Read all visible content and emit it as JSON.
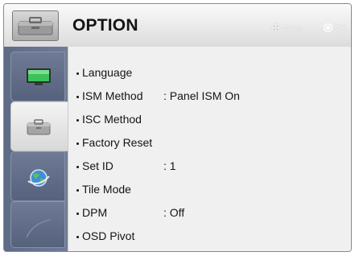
{
  "header": {
    "title": "OPTION",
    "hint_move": "Move",
    "hint_ok": "OK",
    "icon": "toolbox-icon"
  },
  "sidebar": {
    "tabs": [
      {
        "icon": "monitor-icon",
        "active": false
      },
      {
        "icon": "toolbox-icon",
        "active": true
      },
      {
        "icon": "network-globe-icon",
        "active": false
      },
      {
        "icon": "blank-tab",
        "active": false
      }
    ]
  },
  "menu": {
    "items": [
      {
        "label": "Language",
        "value": ""
      },
      {
        "label": "ISM Method",
        "value": ": Panel ISM On"
      },
      {
        "label": "ISC Method",
        "value": ""
      },
      {
        "label": "Factory Reset",
        "value": ""
      },
      {
        "label": "Set ID",
        "value": ": 1"
      },
      {
        "label": "Tile Mode",
        "value": ""
      },
      {
        "label": "DPM",
        "value": ": Off"
      },
      {
        "label": "OSD Pivot",
        "value": ""
      }
    ]
  },
  "colors": {
    "sidebar": "#64718d",
    "panel": "#f0f0f0",
    "text": "#141414"
  }
}
